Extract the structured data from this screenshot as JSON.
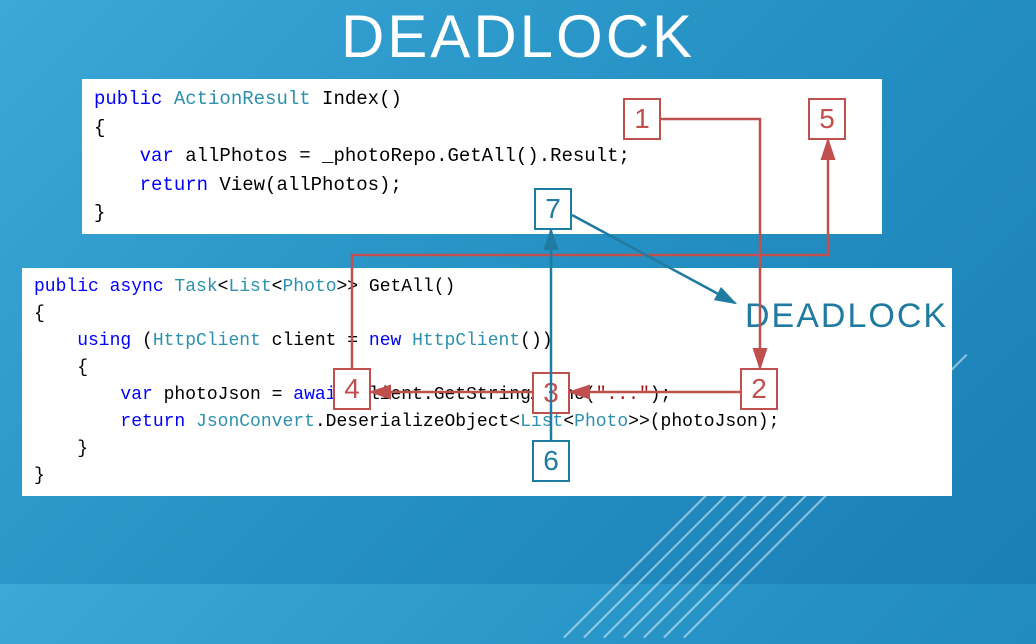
{
  "title": "DEADLOCK",
  "deadlock_label": "DEADLOCK",
  "code1": {
    "l1_kw": "public",
    "l1_type": " ActionResult",
    "l1_rest": " Index()",
    "l2": "{",
    "l3_kw1": "    var",
    "l3_mid": " allPhotos = _photoRepo.GetAll().Result;",
    "l4_kw": "    return",
    "l4_rest": " View(allPhotos);",
    "l5": "}"
  },
  "code2": {
    "l1_kw1": "public",
    "l1_kw2": " async",
    "l1_type1": " Task",
    "l1_lt1": "<",
    "l1_type2": "List",
    "l1_lt2": "<",
    "l1_type3": "Photo",
    "l1_rest": ">> GetAll()",
    "l2": "{",
    "l3_kw": "    using",
    "l3_o": " (",
    "l3_type1": "HttpClient",
    "l3_mid": " client = ",
    "l3_kw2": "new",
    "l3_sp": " ",
    "l3_type2": "HttpClient",
    "l3_end": "())",
    "l4": "    {",
    "l5_kw1": "        var",
    "l5_mid1": " photoJson = ",
    "l5_kw2": "await",
    "l5_mid2": " client.GetStringAsync(",
    "l5_str": "\"...\"",
    "l5_end": ");",
    "l6_kw": "        return",
    "l6_sp": " ",
    "l6_type1": "JsonConvert",
    "l6_mid": ".DeserializeObject<",
    "l6_type2": "List",
    "l6_lt": "<",
    "l6_type3": "Photo",
    "l6_end": ">>(photoJson);",
    "l7": "    }",
    "l8": "}"
  },
  "boxes": {
    "b1": "1",
    "b2": "2",
    "b3": "3",
    "b4": "4",
    "b5": "5",
    "b6": "6",
    "b7": "7"
  }
}
